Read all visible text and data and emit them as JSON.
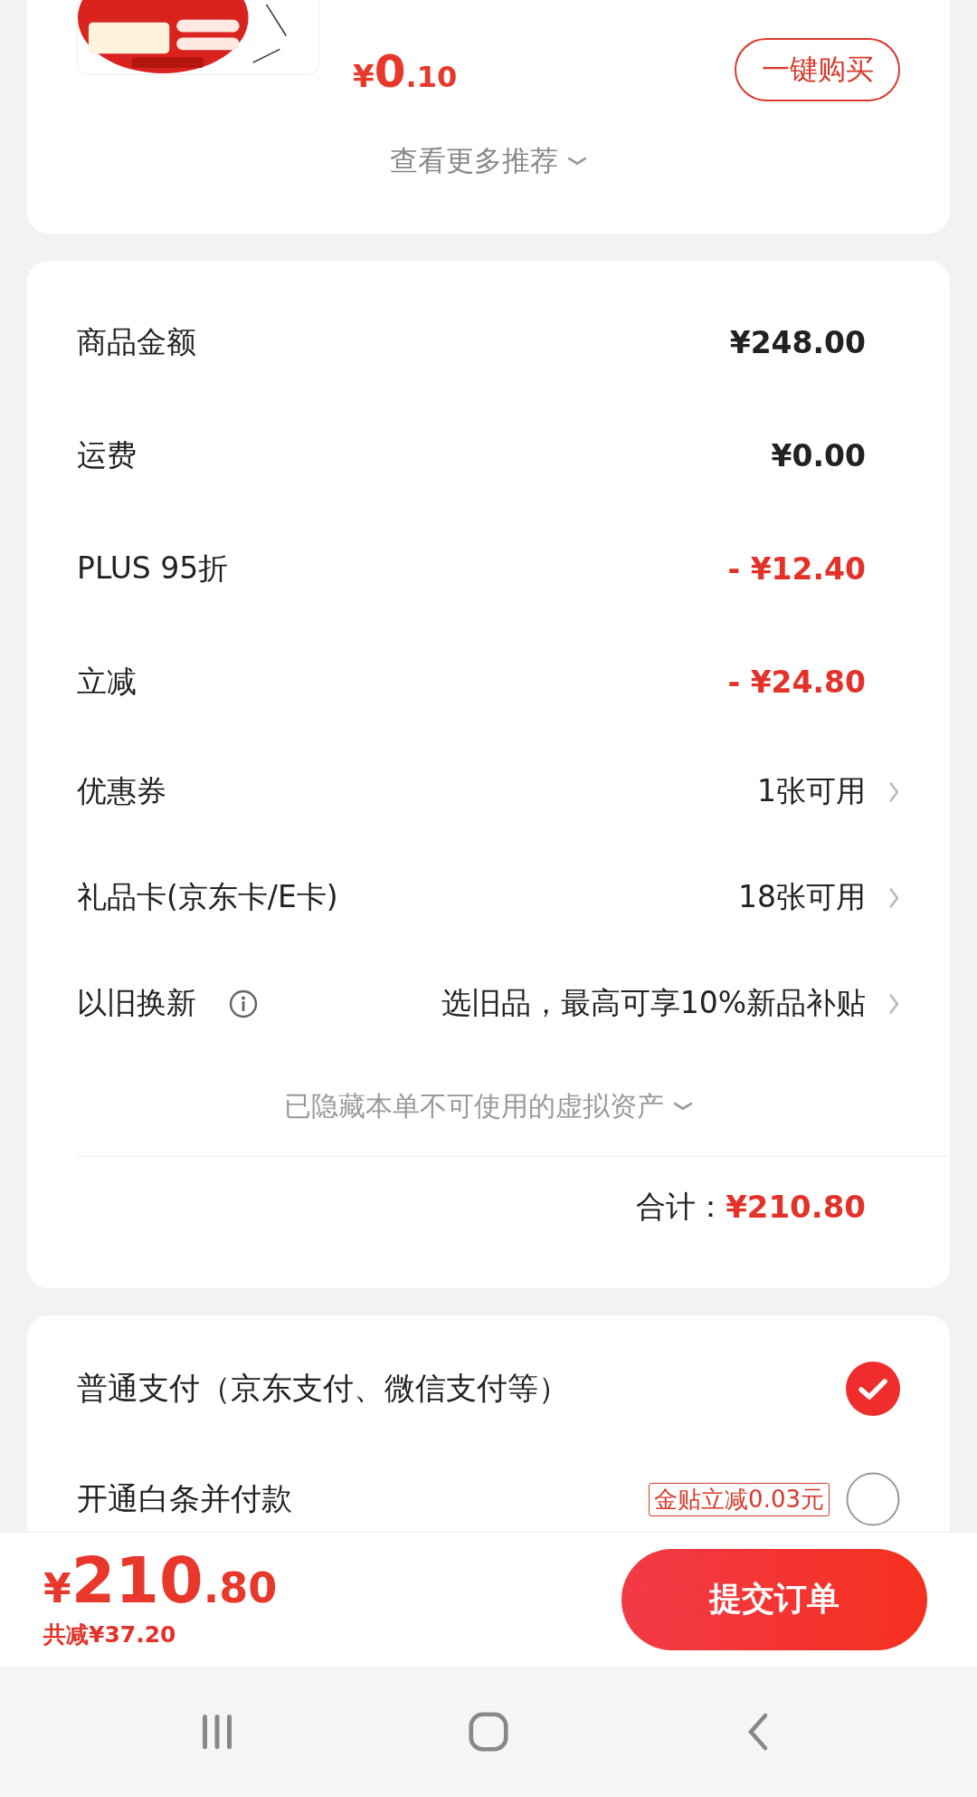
{
  "recommendation": {
    "product": {
      "kind": "picture",
      "price": {
        "currency": "¥",
        "integer": "0",
        "decimal": ".10"
      },
      "buy_button": "一键购买"
    },
    "more_link": "查看更多推荐"
  },
  "summary": {
    "rows": [
      {
        "label": "商品金额",
        "value": "¥248.00",
        "kind": "amount"
      },
      {
        "label": "运费",
        "value": "¥0.00",
        "kind": "amount"
      },
      {
        "label": "PLUS 95折",
        "value": "- ¥12.40",
        "kind": "discount"
      },
      {
        "label": "立减",
        "value": "- ¥24.80",
        "kind": "discount"
      },
      {
        "label": "优惠券",
        "value": "1张可用",
        "kind": "link"
      },
      {
        "label": "礼品卡(京东卡/E卡)",
        "value": "18张可用",
        "kind": "link"
      },
      {
        "label": "以旧换新",
        "value": "选旧品，最高可享10%新品补贴",
        "kind": "link",
        "info": true
      }
    ],
    "hidden_note": "已隐藏本单不可使用的虚拟资产",
    "total_label": "合计：",
    "total_value": "¥210.80"
  },
  "payment_options": [
    {
      "label": "普通支付（京东支付、微信支付等）",
      "selected": true
    },
    {
      "label": "开通白条并付款",
      "selected": false,
      "badge": "金贴立减0.03元"
    }
  ],
  "bottom_bar": {
    "price": {
      "currency": "¥",
      "integer": "210",
      "decimal": ".80"
    },
    "saved": "共减¥37.20",
    "submit_button": "提交订单"
  }
}
